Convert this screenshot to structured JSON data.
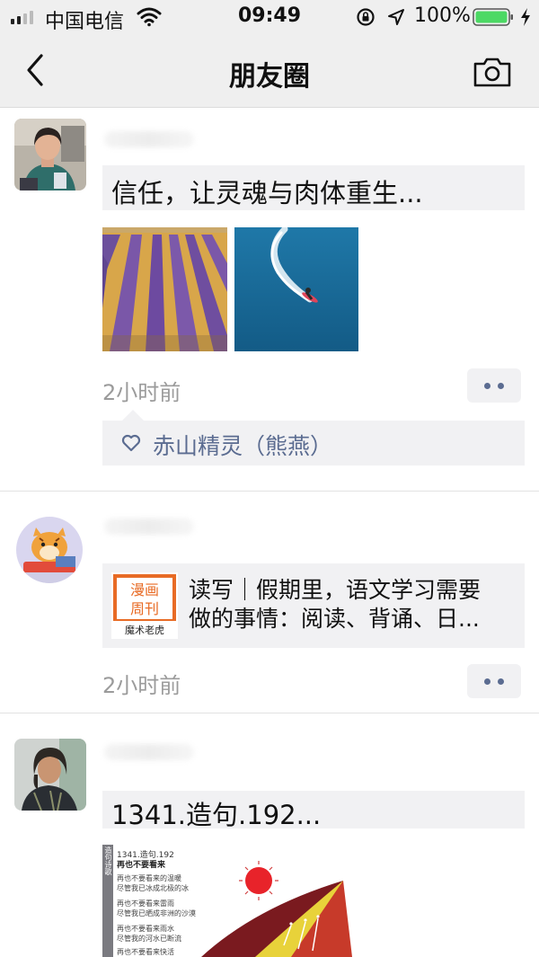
{
  "status_bar": {
    "carrier": "中国电信",
    "time": "09:49",
    "battery": "100%"
  },
  "nav": {
    "title": "朋友圈"
  },
  "posts": [
    {
      "text": "信任，让灵魂与肉体重生...",
      "time": "2小时前",
      "likes": [
        "赤山精灵（熊燕）"
      ]
    },
    {
      "link_title_line1": "读写｜假期里，语文学习需要",
      "link_title_line2": "做的事情：阅读、背诵、日...",
      "link_logo": {
        "line1": "漫画",
        "line2": "周刊",
        "line3": "魔术老虎"
      },
      "time": "2小时前"
    },
    {
      "text": "1341.造句.192...",
      "poster": {
        "side_label": "造句诗歌",
        "header": "1341.造句.192",
        "subtitle": "再也不要看来",
        "lines": [
          "再也不要看来的温暖",
          "尽管我已冰成北极的冰",
          "再也不要看来雷雨",
          "尽管我已晒成非洲的沙漠",
          "再也不要看来雨水",
          "尽管我的河水已断流",
          "再也不要看来快活"
        ]
      }
    }
  ],
  "colors": {
    "link_blue": "#5b6c91",
    "panel_gray": "#f1f1f3",
    "time_gray": "#9b9b9b",
    "battery_green": "#4cd964"
  }
}
